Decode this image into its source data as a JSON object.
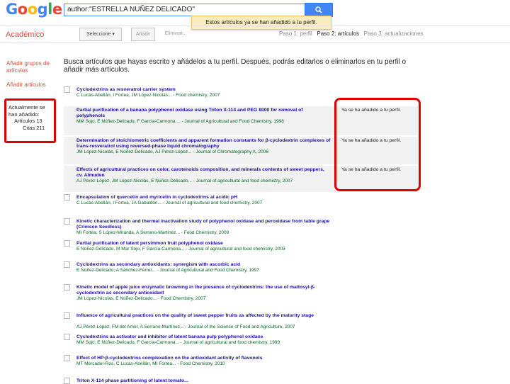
{
  "header": {
    "logo_letters": [
      {
        "char": "G",
        "color": "#4285f4"
      },
      {
        "char": "o",
        "color": "#ea4335"
      },
      {
        "char": "o",
        "color": "#fbbc05"
      },
      {
        "char": "g",
        "color": "#4285f4"
      },
      {
        "char": "l",
        "color": "#34a853"
      },
      {
        "char": "e",
        "color": "#ea4335"
      }
    ],
    "search_value": "author:\"ESTRELLA NUÑEZ DELICADO\"",
    "search_icon": "magnifier-icon",
    "notice": "Estos artículos ya se han añadido a tu perfil."
  },
  "toolbar": {
    "section_title": "Académico",
    "add_to_profile": "Seleccione ▾",
    "add_button": "Añadir",
    "remove_link": "Eliminar...",
    "step1": "Paso 1: perfil",
    "step2": "Paso 2: artículos",
    "step3": "Paso 3: actualizaciones"
  },
  "sidebar": {
    "add_groups": "Añadir grupos de artículos",
    "add_articles": "Añadir artículos",
    "box_line1": "Actualmente se han añadido:",
    "box_line2": "Artículos 13",
    "box_line3": "Citas 211"
  },
  "intro": "Busca artículos que hayas escrito y añádelos a tu perfil. Después, podrás editarlos o eliminarlos en tu perfil o añadir más artículos.",
  "accent_colors": {
    "link": "#1a0dab",
    "meta": "#006621",
    "highlight_border": "#dd0000",
    "section_red": "#dd4b39"
  },
  "articles": [
    {
      "title": "Cyclodextrins as resveratrol carrier system",
      "meta": "C Lucas-Abellán, I Fortea, JM López-Nicolás... - Food chemistry, 2007",
      "added": ""
    },
    {
      "title": "Partial purification of a banana polyphenol oxidase using Triton X-114 and PEG 8000 for removal of polyphenols",
      "meta": "MM Sojo, E Núñez-Delicado, F García-Carmona ... - Journal of Agricultural and Food Chemistry, 1998",
      "added": "Ya se ha añadido a tu perfil."
    },
    {
      "title": "Determination of stoichiometric coefficients and apparent formation constants for β-cyclodextrin complexes of trans-resveratrol using reversed-phase liquid chromatography",
      "meta": "JM López-Nicolás, E Núñez-Delicado, AJ Pérez-López... - Journal of Chromatography A, 2006",
      "added": "Ya se ha añadido a tu perfil."
    },
    {
      "title": "Effects of agricultural practices on color, carotenoids composition, and minerals contents of sweet peppers, cv. Almuden",
      "meta": "AJ Pérez-López, JM López-Nicolás, E Núñez-Delicado... - Journal of agricultural and food chemistry, 2007",
      "added": "Ya se ha añadido a tu perfil."
    },
    {
      "title": "Encapsulation of quercetin and myricetin in cyclodextrins at acidic pH",
      "meta": "C Lucas-Abellán, I Fortea, JA Gabaldón... - Journal of agricultural and food chemistry, 2007",
      "added": ""
    },
    {
      "title": "Kinetic characterization and thermal inactivation study of polyphenol oxidase and peroxidase from table grape (Crimson Seedless)",
      "meta": "MI Fortea, S López-Miranda, A Serrano-Martínez... - Food Chemistry, 2009",
      "added": ""
    },
    {
      "title": "Partial purification of latent persimmon fruit polyphenol oxidase",
      "meta": "E Núñez-Delicado, M Mar Sojo, F García-Carmona... - Journal of agricultural and food chemistry, 2003",
      "added": ""
    },
    {
      "title": "Cyclodextrins as secondary antioxidants: synergism with ascorbic acid",
      "meta": "E Núñez-Delicado, A Sánchez-Ferrer... - Journal of Agricultural and Food Chemistry, 1997",
      "added": ""
    },
    {
      "title": "Kinetic model of apple juice enzymatic browning in the presence of cyclodextrins: the use of maltosyl-β-cyclodextrin as secondary antioxidant",
      "meta": "JM López-Nicolás, E Núñez-Delicado... - Food Chemistry, 2007",
      "added": ""
    },
    {
      "title": "Influence of agricultural practices on the quality of sweet pepper fruits as affected by the maturity stage",
      "meta": "AJ Pérez-López, FM del Amor, A Serrano-Martínez... - Journal of the Science of Food and Agriculture, 2007",
      "added": ""
    },
    {
      "title": "Cyclodextrins as activator and inhibitor of latent banana pulp polyphenol oxidase",
      "meta": "MM Sojo, E Núñez-Delicado, F García-Carmona... - Journal of agricultural and food chemistry, 1999",
      "added": ""
    },
    {
      "title": "Effect of HP-β-cyclodextrins complexation on the antioxidant activity of flavonols",
      "meta": "MT Mercader-Ros, C Lucas-Abellán, MI Fortea... - Food Chemistry, 2010",
      "added": ""
    },
    {
      "title": "Triton X-114 phase partitioning of latent tomato...",
      "meta": "",
      "added": ""
    }
  ]
}
